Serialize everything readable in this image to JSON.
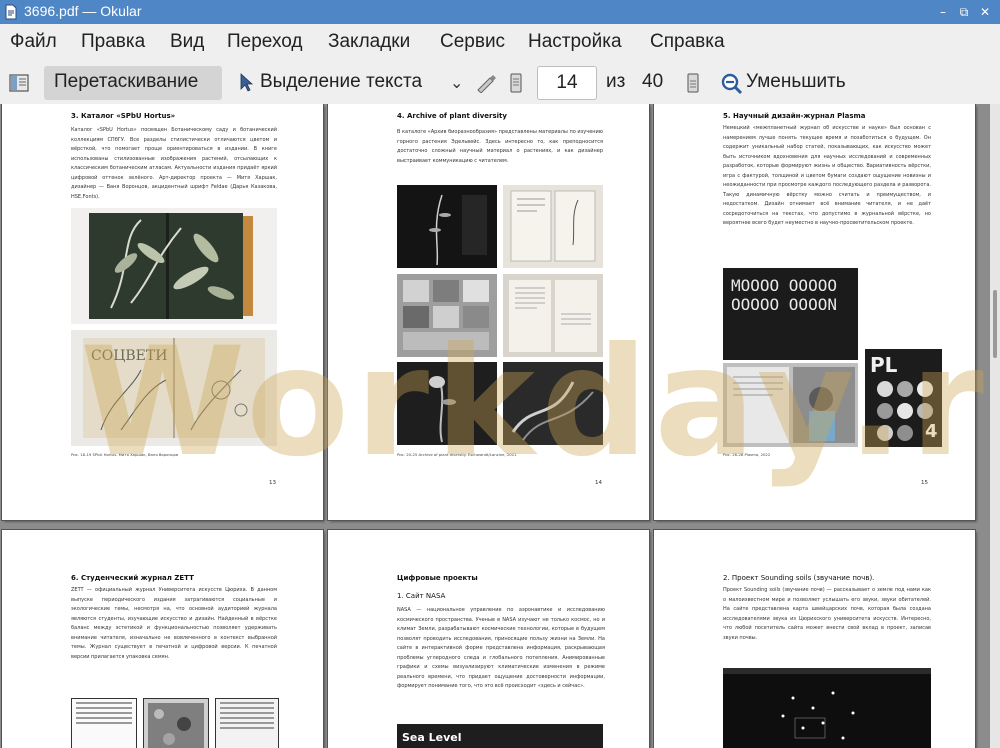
{
  "window": {
    "title": "3696.pdf  — Okular"
  },
  "menu": [
    "Файл",
    "Правка",
    "Вид",
    "Переход",
    "Закладки",
    "Сервис",
    "Настройка",
    "Справка"
  ],
  "toolbar": {
    "browse_label": "Перетаскивание",
    "select_label": "Выделение текста",
    "page_current": "14",
    "page_of": "из",
    "page_total": "40",
    "zoom_out_label": "Уменьшить"
  },
  "watermark": "Workday.ru",
  "pages": [
    {
      "heading": "3.  Каталог «SPbU Hortus»",
      "body": "Каталог «SPbU Hortus» посвящен Ботаническому саду и ботанический коллекциям СПбГУ. Все разделы стилистически отличаются цветом и вёрсткой, что помогает проще ориентироваться в издании. В книге использованы стилизованные изображения растений, отсылающих к классическим ботаническим атласам. Актуальности издания придаёт яркий цифровой оттенок зелёного. Арт-директор проекта — Митя Харшак, дизайнер — Ваня Воронцов, акцидентный шрифт Feldae (Дарья Казакова, HSE.Fonts).",
      "caption": "Рис. 18-19  SPbU Hortus. Митя Харшак, Ваня Воронцов",
      "number": "13"
    },
    {
      "heading": "4.  Archive of plant diversity",
      "body": "В каталоге «Архив биоразнообразия» представлены материалы по изучению горного растения Эдельвейс. Здесь интересно то, как преподносится достаточно сложный научный материал о растениях, и как дизайнер выстраивает коммуникацию с читателем.",
      "caption": "Рис. 20-25  Archive of plant diversity. Eschwandt/Lanzine, 2021",
      "number": "14"
    },
    {
      "heading": "5.  Научный дизайн-журнал Plasma",
      "body": "Немецкий «межпланетный журнал об искусстве и науке» был основан с намерением лучше понять текущее время и позаботиться о будущем. Он содержит уникальный набор статей, показывающих, как искусство может быть источником вдохновения для научных исследований и современных разработок, которые формируют жизнь и общество. Вариативность вёрстки, игра с фактурой, толщиной и цветом бумаги создают ощущение новизны и неожиданности при просмотре каждого последующего раздела и разворота. Такую динамичную вёрстку можно считать и преимуществом, и недостатком. Дизайн отнимает всё внимание читателя, и не даёт сосредоточиться на текстах, что допустимо в журнальной вёрстке, но вероятнее всего будет неуместно в научно-просветительском проекте.",
      "caption": "Рис. 26-28  Plasma, 2022",
      "number": "15",
      "plasma_letters": "MOOOO OOOOO OOOOO OOOON",
      "plasma_logo": "PL",
      "plasma_num": "4"
    },
    {
      "heading": "6. Студенческий журнал ZETT",
      "body": "ZETT — официальный журнал Университета искусств Цюриха. В данном выпуске периодического издания затрагиваются социальные и экологические темы, несмотря на, что основной аудиторией журнала являются студенты, изучающие искусство и дизайн. Найденный в вёрстке баланс между эстетикой и функциональностью позволяет удерживать внимание читателя, изначально не вовлеченного в контекст выбранной темы. Журнал существует в печатной и цифровой версии. К печатной версии прилагается упаковка семян."
    },
    {
      "heading": "Цифровые проекты",
      "subheading": "1.  Сайт NASA",
      "body": "NASA — национальное управление по аэронавтике и исследованию космического пространства. Ученые в NASA изучают не только космос, но и климат Земли, разрабатывают космические технологии, которые в будущем позволят проводить исследования, приносящие пользу жизни на Земли. На сайте в интерактивной форме представлена информация, раскрывающая проблемы углеродного следа и глобального потепления. Анимированные графики и схемы визуализируют климатические изменения в режиме реального времени, что придает ощущение достоверности информации, формирует понимание того, что это всё происходит «здесь и сейчас».",
      "image_label": "Sea Level"
    },
    {
      "heading": "2. Проект Sounding soils (звучание почв).",
      "body": "Проект Sounding soils (звучание почв) — рассказывает о земле под нами как о малоизвестном мире и позволяет услышать его звуки, звуки обитателей. На сайте представлена карта швейцарских почв, которая была создана исследователями звука из Цюрихского университета искусств. Интересно, что любой посетитель сайта может внести свой вклад в проект, записав звуки почвы."
    }
  ],
  "colors": {
    "titlebar": "#4f86c6",
    "chrome": "#efefef",
    "viewport": "#8c8c8c",
    "watermark": "#cda555"
  }
}
